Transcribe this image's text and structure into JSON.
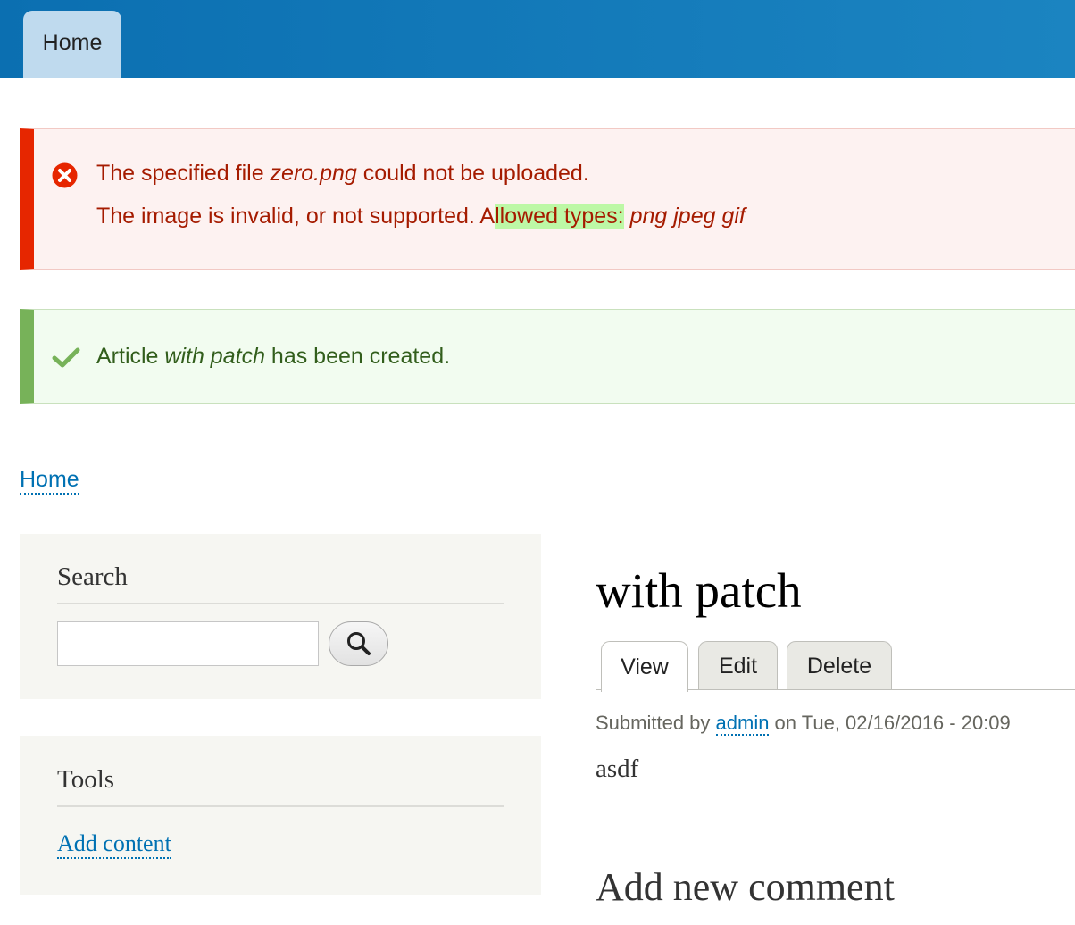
{
  "nav": {
    "home_tab": "Home"
  },
  "messages": {
    "error": {
      "line1_prefix": "The specified file ",
      "line1_file": "zero.png",
      "line1_suffix": " could not be uploaded.",
      "line2_prefix": "The image is invalid, or not supported. A",
      "line2_highlight": "llowed types:",
      "line2_space": " ",
      "line2_types": "png jpeg gif"
    },
    "status": {
      "prefix": "Article ",
      "title": "with patch",
      "suffix": " has been created."
    }
  },
  "breadcrumb": {
    "home": "Home"
  },
  "sidebar": {
    "search": {
      "title": "Search",
      "input_value": ""
    },
    "tools": {
      "title": "Tools",
      "add_content": "Add content"
    }
  },
  "node": {
    "title": "with patch",
    "tabs": [
      "View",
      "Edit",
      "Delete"
    ],
    "meta": {
      "submitted_by": "Submitted by ",
      "author": "admin",
      "date": " on Tue, 02/16/2016 - 20:09"
    },
    "body": "asdf",
    "add_comment": "Add new comment"
  },
  "colors": {
    "nav_bar": "#1b84c1",
    "error_accent": "#e62600",
    "status_accent": "#77b259",
    "link": "#0071b3"
  },
  "icons": {
    "error": "error-circle-x-icon",
    "status": "checkmark-icon",
    "search": "search-icon"
  }
}
